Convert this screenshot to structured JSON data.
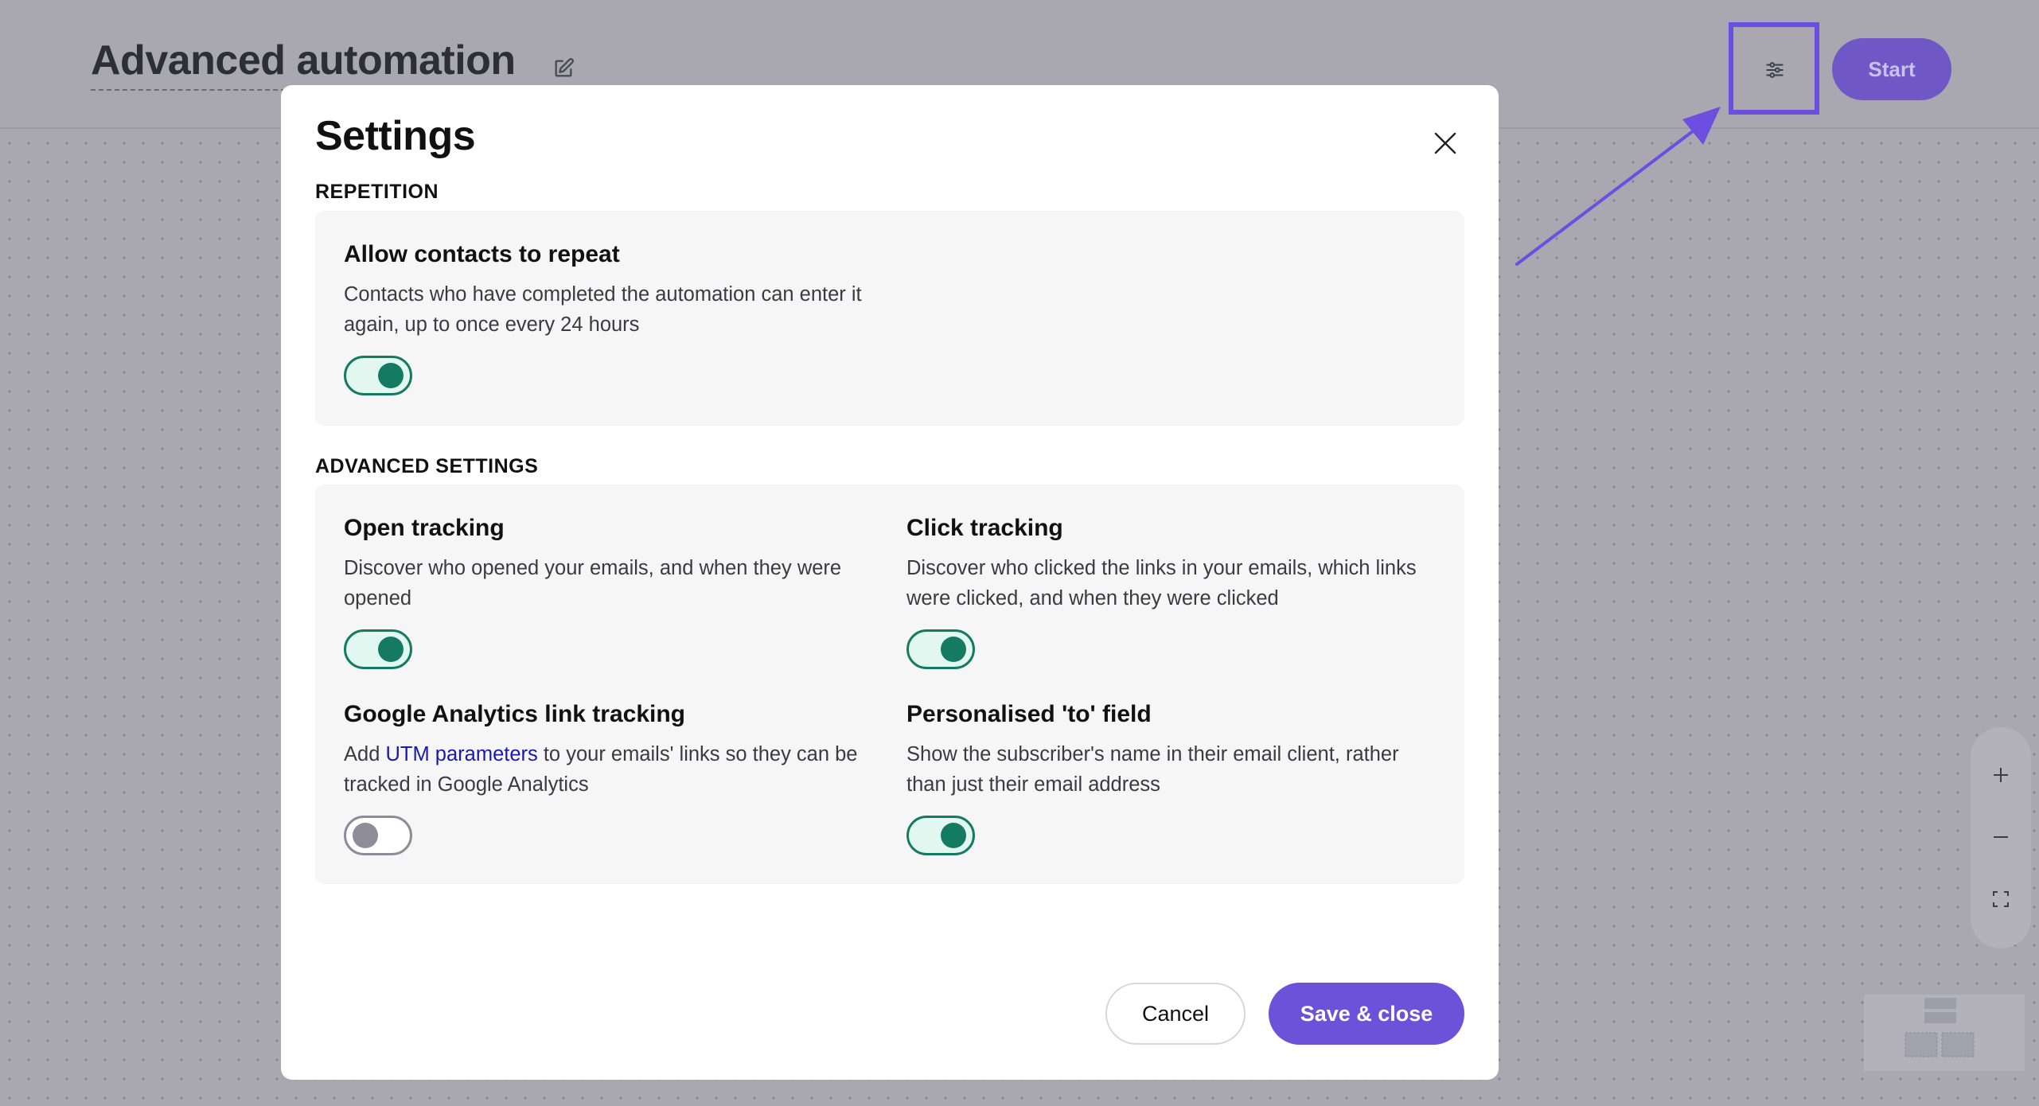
{
  "header": {
    "title": "Advanced automation",
    "edit_icon": "pencil-edit-icon",
    "settings_icon": "sliders-icon",
    "start_label": "Start"
  },
  "modal": {
    "title": "Settings",
    "close_icon": "close-icon",
    "sections": {
      "repetition": {
        "label": "REPETITION",
        "allow_repeat": {
          "title": "Allow contacts to repeat",
          "desc": "Contacts who have completed the automation can enter it again, up to once every 24 hours",
          "enabled": true
        }
      },
      "advanced": {
        "label": "ADVANCED SETTINGS",
        "open_tracking": {
          "title": "Open tracking",
          "desc": "Discover who opened your emails, and when they were opened",
          "enabled": true
        },
        "click_tracking": {
          "title": "Click tracking",
          "desc": "Discover who clicked the links in your emails, which links were clicked, and when they were clicked",
          "enabled": true
        },
        "ga_tracking": {
          "title": "Google Analytics link tracking",
          "desc_prefix": "Add ",
          "desc_link": "UTM parameters",
          "desc_suffix": " to your emails' links so they can be tracked in Google Analytics",
          "enabled": false
        },
        "personalised_to": {
          "title": "Personalised 'to' field",
          "desc": "Show the subscriber's name in their email client, rather than just their email address",
          "enabled": true
        }
      }
    },
    "cancel_label": "Cancel",
    "save_label": "Save & close"
  },
  "zoom": {
    "zoom_in_icon": "plus-icon",
    "zoom_out_icon": "minus-icon",
    "fit_icon": "fit-screen-icon"
  },
  "colors": {
    "accent": "#6c52d9",
    "toggle_on": "#157a62",
    "toggle_off": "#8e8c99",
    "link": "#1a1aa8",
    "highlight": "#6c4fe0"
  }
}
